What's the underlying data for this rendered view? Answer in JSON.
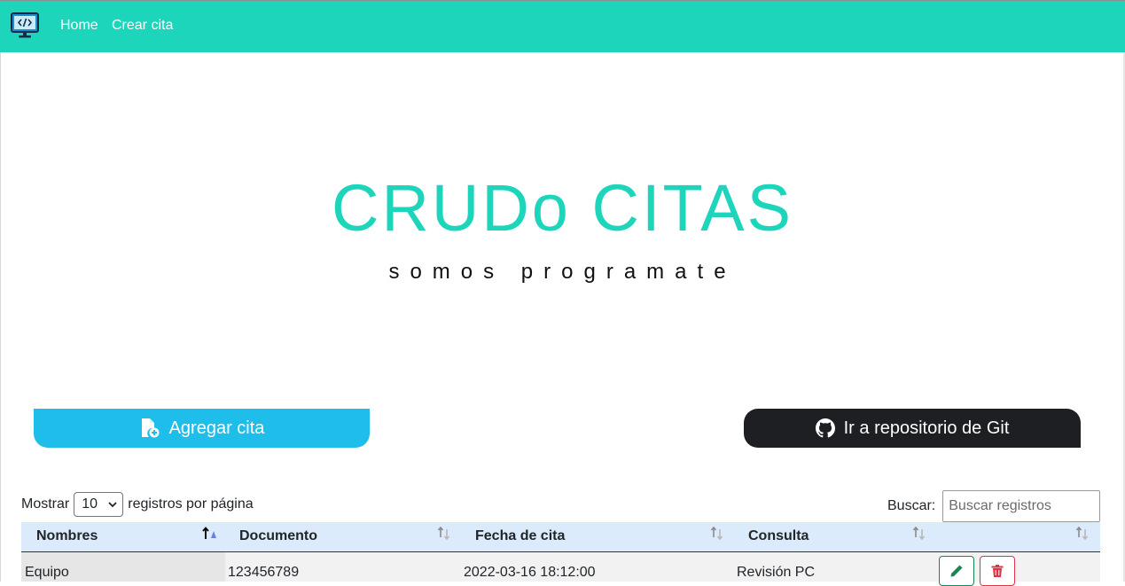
{
  "navbar": {
    "brand_icon": "code-monitor-icon",
    "links": [
      {
        "label": "Home"
      },
      {
        "label": "Crear cita"
      }
    ],
    "background": "#1dd5bb"
  },
  "hero": {
    "title": "CRUDo CITAS",
    "subtitle": "somos programate",
    "title_color": "#1dd5bb"
  },
  "actions": {
    "add": {
      "label": "Agregar cita",
      "icon": "file-plus-icon",
      "color": "#1fbde9"
    },
    "git": {
      "label": "Ir a repositorio de Git",
      "icon": "github-icon",
      "color": "#1e1f22"
    }
  },
  "table_controls": {
    "show_label": "Mostrar",
    "page_size": "10",
    "per_page_label": "registros por página",
    "search_label": "Buscar:",
    "search_placeholder": "Buscar registros"
  },
  "table": {
    "columns": [
      "Nombres",
      "Documento",
      "Fecha de cita",
      "Consulta",
      ""
    ],
    "rows": [
      {
        "nombres": "Equipo",
        "documento": "123456789",
        "fecha": "2022-03-16 18:12:00",
        "consulta": "Revisión PC"
      }
    ],
    "row_actions": {
      "edit_icon": "pencil-icon",
      "delete_icon": "trash-icon"
    }
  }
}
